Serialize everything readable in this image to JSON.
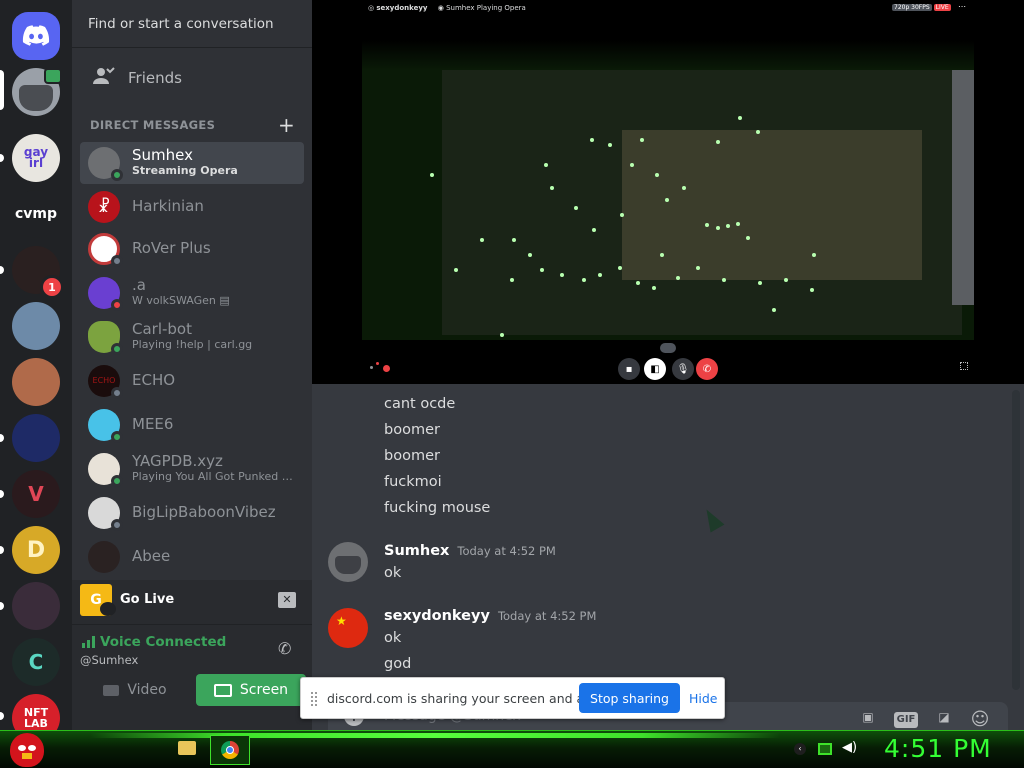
{
  "search": {
    "placeholder": "Find or start a conversation"
  },
  "friends_label": "Friends",
  "direct_messages_header": "DIRECT MESSAGES",
  "dms": [
    {
      "name": "Sumhex",
      "sub": "Streaming Opera",
      "status_color": "#3ba55c",
      "avatar_color": "#6d6f72"
    },
    {
      "name": "Harkinian",
      "sub": "",
      "status_color": "",
      "avatar_color": "#b8131b"
    },
    {
      "name": "RoVer Plus",
      "sub": "",
      "status_color": "#747f8d",
      "avatar_color": "#c23b3b"
    },
    {
      "name": ".a",
      "sub": "volkSWAGen",
      "status_color": "#ed4245",
      "avatar_color": "#6a3fd1"
    },
    {
      "name": "Carl-bot",
      "sub": "Playing !help | carl.gg",
      "status_color": "#3ba55c",
      "avatar_color": "#7ca33f"
    },
    {
      "name": "ECHO",
      "sub": "",
      "status_color": "#747f8d",
      "avatar_color": "#1a0c0c"
    },
    {
      "name": "MEE6",
      "sub": "",
      "status_color": "#3ba55c",
      "avatar_color": "#48c2e8"
    },
    {
      "name": "YAGPDB.xyz",
      "sub": "Playing You All Got Punked Du...",
      "status_color": "#3ba55c",
      "avatar_color": "#e8e2d8"
    },
    {
      "name": "BigLipBaboonVibez",
      "sub": "",
      "status_color": "#747f8d",
      "avatar_color": "#d9d9d9"
    },
    {
      "name": "Abee",
      "sub": "",
      "status_color": "",
      "avatar_color": "#2a2222"
    }
  ],
  "go_live": {
    "label": "Go Live",
    "icon_letter": "G"
  },
  "voice": {
    "status": "Voice Connected",
    "channel": "@Sumhex",
    "video_label": "Video",
    "screen_label": "Screen"
  },
  "servers": {
    "cvmp_label": "cvmp",
    "gay_label": "gay irl",
    "nft_label": "NFT LAB",
    "mention_count": "1"
  },
  "stream": {
    "streamer": "sexydonkeyy",
    "title": "Sumhex Playing Opera",
    "quality": "720p 30FPS",
    "live": "LIVE"
  },
  "chat": {
    "messages_top": [
      "cant ocde",
      "boomer",
      "boomer",
      "fuckmoi",
      "fucking mouse"
    ],
    "groups": [
      {
        "author": "Sumhex",
        "time": "Today at 4:52 PM",
        "lines": [
          "ok"
        ]
      },
      {
        "author": "sexydonkeyy",
        "time": "Today at 4:52 PM",
        "lines": [
          "ok",
          "god"
        ]
      }
    ],
    "composer_placeholder": "Message @Sumhex",
    "gif_label": "GIF"
  },
  "share_bar": {
    "text": "discord.com is sharing your screen and audio.",
    "stop_label": "Stop sharing",
    "hide_label": "Hide"
  },
  "taskbar": {
    "clock": "4:51 PM"
  },
  "colors": {
    "blurple": "#5865f2",
    "green": "#3ba55c",
    "red": "#ed4245",
    "taskbar_green": "#34ff34"
  }
}
